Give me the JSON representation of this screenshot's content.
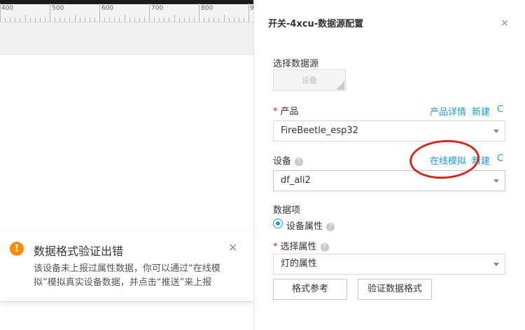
{
  "ruler": {
    "labels": [
      "400",
      "500",
      "600",
      "700",
      "800",
      "9"
    ]
  },
  "toast": {
    "icon": "!",
    "title": "数据格式验证出错",
    "body": "该设备未上报过属性数据，你可以通过“在线模拟”模拟真实设备数据，并点击“推送”来上报",
    "close": "×"
  },
  "panel": {
    "title": "开关-4xcu-数据源配置",
    "close": "×",
    "source": {
      "label": "选择数据源",
      "button_label": "设备"
    },
    "product": {
      "required_mark": "*",
      "label": "产品",
      "link_detail": "产品详情",
      "link_new": "新建",
      "refresh": "C",
      "value": "FireBeetle_esp32"
    },
    "device": {
      "label": "设备",
      "help": "?",
      "link_simulate": "在线模拟",
      "link_new": "新建",
      "refresh": "C",
      "value": "df_ali2"
    },
    "data_item": {
      "label": "数据项",
      "radio_label": "设备属性",
      "help": "?"
    },
    "attribute": {
      "required_mark": "*",
      "label": "选择属性",
      "help": "?",
      "value": "灯的属性"
    },
    "buttons": {
      "format_ref": "格式参考",
      "validate": "验证数据格式"
    }
  },
  "colors": {
    "accent": "#1a9bd7",
    "warning": "#ff8c00",
    "annotation": "#d9261c"
  }
}
